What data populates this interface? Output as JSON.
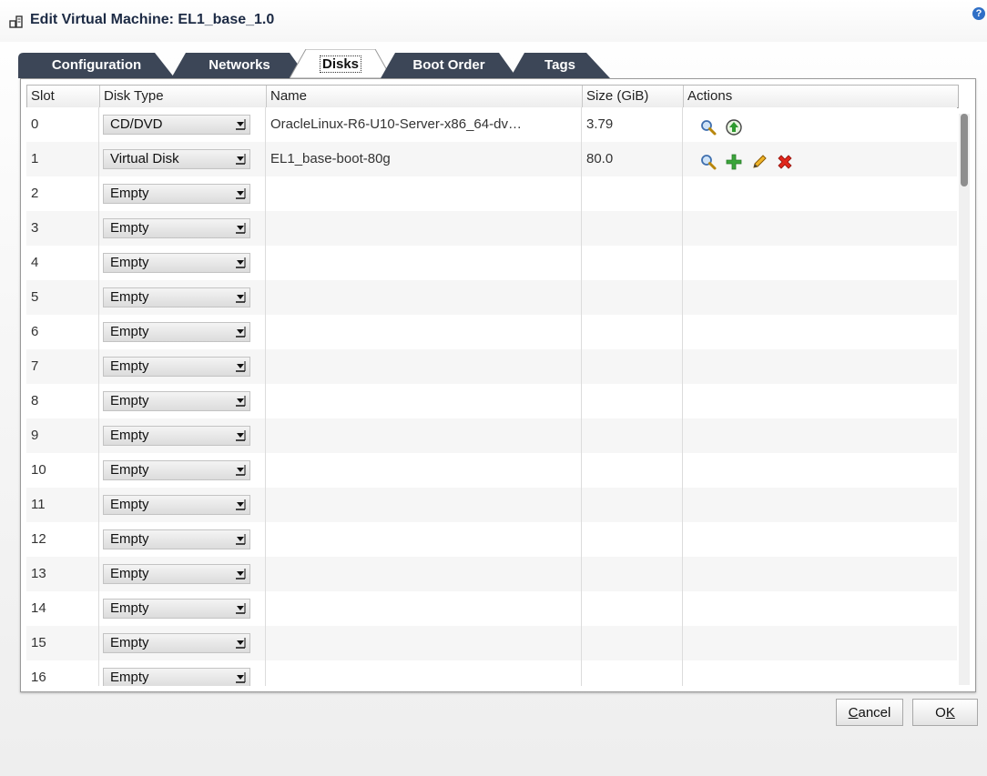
{
  "dialog": {
    "title": "Edit Virtual Machine: EL1_base_1.0",
    "help_icon": "help-icon",
    "help_glyph": "?"
  },
  "tabs": [
    {
      "label": "Configuration",
      "active": false
    },
    {
      "label": "Networks",
      "active": false
    },
    {
      "label": "Disks",
      "active": true
    },
    {
      "label": "Boot Order",
      "active": false
    },
    {
      "label": "Tags",
      "active": false
    }
  ],
  "table": {
    "columns": [
      "Slot",
      "Disk Type",
      "Name",
      "Size (GiB)",
      "Actions"
    ],
    "rows": [
      {
        "slot": "0",
        "disk_type": "CD/DVD",
        "name": "OracleLinux-R6-U10-Server-x86_64-dv…",
        "size": "3.79",
        "actions": [
          "search-icon",
          "eject-icon"
        ]
      },
      {
        "slot": "1",
        "disk_type": "Virtual Disk",
        "name": "EL1_base-boot-80g",
        "size": "80.0",
        "actions": [
          "search-icon",
          "add-icon",
          "edit-icon",
          "delete-icon"
        ]
      },
      {
        "slot": "2",
        "disk_type": "Empty",
        "name": "",
        "size": "",
        "actions": []
      },
      {
        "slot": "3",
        "disk_type": "Empty",
        "name": "",
        "size": "",
        "actions": []
      },
      {
        "slot": "4",
        "disk_type": "Empty",
        "name": "",
        "size": "",
        "actions": []
      },
      {
        "slot": "5",
        "disk_type": "Empty",
        "name": "",
        "size": "",
        "actions": []
      },
      {
        "slot": "6",
        "disk_type": "Empty",
        "name": "",
        "size": "",
        "actions": []
      },
      {
        "slot": "7",
        "disk_type": "Empty",
        "name": "",
        "size": "",
        "actions": []
      },
      {
        "slot": "8",
        "disk_type": "Empty",
        "name": "",
        "size": "",
        "actions": []
      },
      {
        "slot": "9",
        "disk_type": "Empty",
        "name": "",
        "size": "",
        "actions": []
      },
      {
        "slot": "10",
        "disk_type": "Empty",
        "name": "",
        "size": "",
        "actions": []
      },
      {
        "slot": "11",
        "disk_type": "Empty",
        "name": "",
        "size": "",
        "actions": []
      },
      {
        "slot": "12",
        "disk_type": "Empty",
        "name": "",
        "size": "",
        "actions": []
      },
      {
        "slot": "13",
        "disk_type": "Empty",
        "name": "",
        "size": "",
        "actions": []
      },
      {
        "slot": "14",
        "disk_type": "Empty",
        "name": "",
        "size": "",
        "actions": []
      },
      {
        "slot": "15",
        "disk_type": "Empty",
        "name": "",
        "size": "",
        "actions": []
      },
      {
        "slot": "16",
        "disk_type": "Empty",
        "name": "",
        "size": "",
        "actions": []
      }
    ]
  },
  "buttons": {
    "cancel": {
      "mnemonic": "C",
      "rest": "ancel"
    },
    "ok": {
      "prefix": "O",
      "mnemonic": "K"
    }
  },
  "colors": {
    "tab_bg": "#3c4657",
    "tab_active_bg": "#ffffff",
    "accent": "#2f6fc6"
  }
}
